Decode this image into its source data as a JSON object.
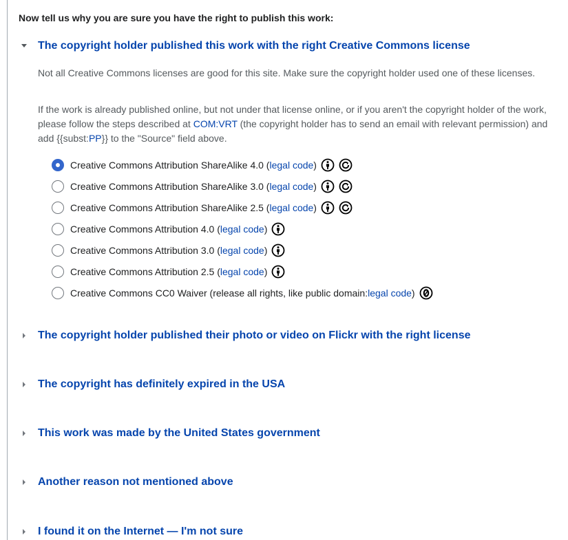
{
  "intro_text": "Now tell us why you are sure you have the right to publish this work:",
  "expanded_section": {
    "title": "The copyright holder published this work with the right Creative Commons license",
    "para1": "Not all Creative Commons licenses are good for this site. Make sure the copyright holder used one of these licenses.",
    "para2": {
      "text_before_link1": "If the work is already published online, but not under that license online, or if you aren't the copyright holder of the work, please follow the steps described at ",
      "link1": "COM:VRT",
      "text_between": " (the copyright holder has to send an email with relevant permission) and add {{subst:",
      "link2": "PP",
      "text_after": "}} to the \"Source\" field above."
    },
    "options": [
      {
        "label": "Creative Commons Attribution ShareAlike 4.0 (",
        "link": "legal code",
        "suffix": ")",
        "checked": true,
        "icons": [
          "attribution-icon",
          "sharealike-icon"
        ]
      },
      {
        "label": "Creative Commons Attribution ShareAlike 3.0 (",
        "link": "legal code",
        "suffix": ")",
        "checked": false,
        "icons": [
          "attribution-icon",
          "sharealike-icon"
        ]
      },
      {
        "label": "Creative Commons Attribution ShareAlike 2.5 (",
        "link": "legal code",
        "suffix": ")",
        "checked": false,
        "icons": [
          "attribution-icon",
          "sharealike-icon"
        ]
      },
      {
        "label": "Creative Commons Attribution 4.0 (",
        "link": "legal code",
        "suffix": ")",
        "checked": false,
        "icons": [
          "attribution-icon"
        ]
      },
      {
        "label": "Creative Commons Attribution 3.0 (",
        "link": "legal code",
        "suffix": ")",
        "checked": false,
        "icons": [
          "attribution-icon"
        ]
      },
      {
        "label": "Creative Commons Attribution 2.5 (",
        "link": "legal code",
        "suffix": ")",
        "checked": false,
        "icons": [
          "attribution-icon"
        ]
      },
      {
        "label": "Creative Commons CC0 Waiver (release all rights, like public domain: ",
        "link": "legal code",
        "suffix": ")",
        "checked": false,
        "icons": [
          "cc0-icon"
        ]
      }
    ]
  },
  "collapsed_sections": [
    "The copyright holder published their photo or video on Flickr with the right license",
    "The copyright has definitely expired in the USA",
    "This work was made by the United States government",
    "Another reason not mentioned above",
    "I found it on the Internet — I'm not sure"
  ],
  "colors": {
    "link": "#0645ad",
    "radio_checked": "#3366cc",
    "body_text": "#202122",
    "muted_text": "#54595d"
  }
}
